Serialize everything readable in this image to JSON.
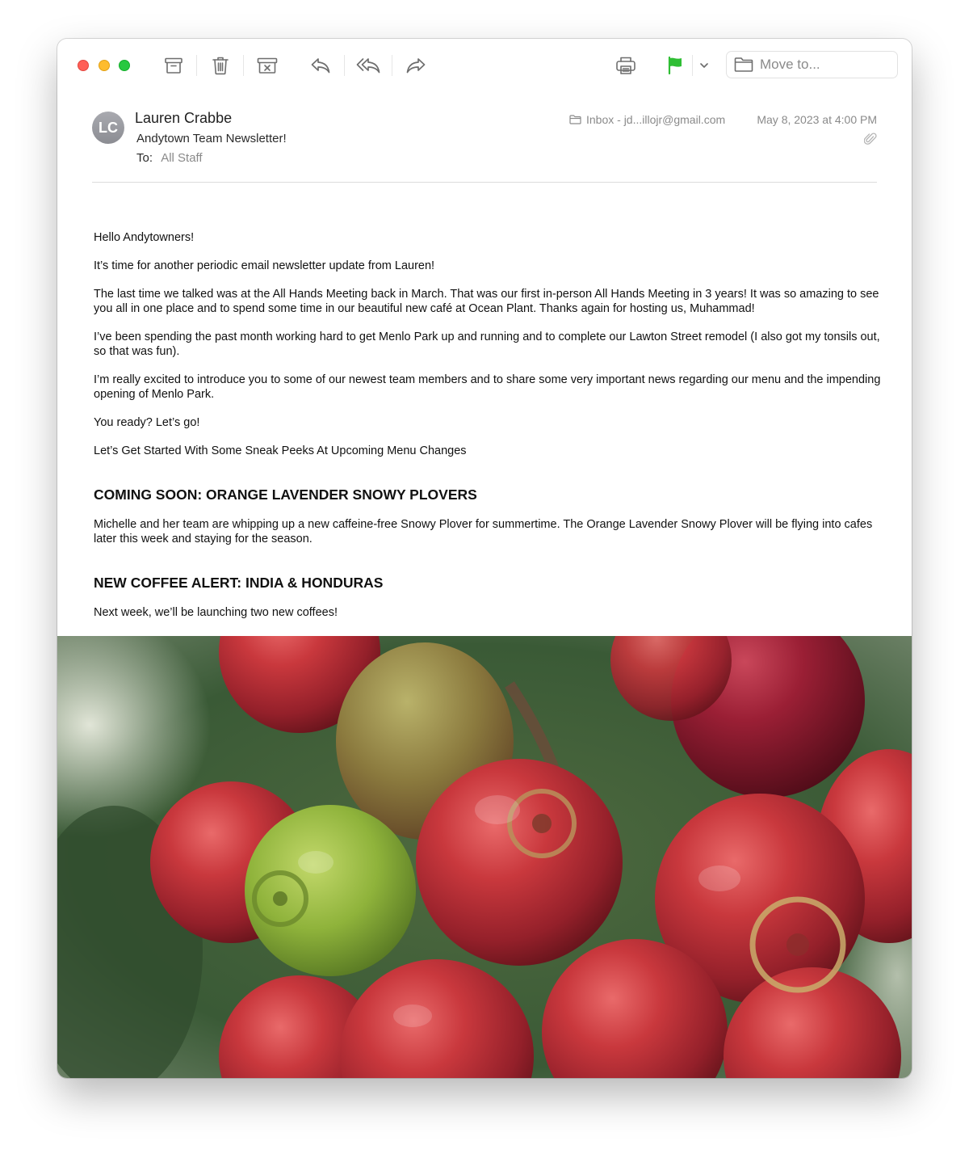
{
  "toolbar": {
    "icons": [
      "archive-icon",
      "trash-icon",
      "junk-icon",
      "reply-icon",
      "reply-all-icon",
      "forward-icon",
      "print-icon",
      "flag-icon",
      "chevron-down-icon"
    ],
    "move_to_label": "Move to...",
    "flag_color": "#2fbe34"
  },
  "message": {
    "avatar_initials": "LC",
    "sender": "Lauren Crabbe",
    "subject": "Andytown Team Newsletter!",
    "to_label": "To:",
    "to_value": "All Staff",
    "mailbox": "Inbox - jd...illojr@gmail.com",
    "date": "May 8, 2023 at 4:00 PM"
  },
  "body": {
    "greeting": "Hello Andytowners!",
    "p1": "It’s time for another periodic email newsletter update from Lauren!",
    "p2": "The last time we talked was at the All Hands Meeting back in March. That was our first in-person All Hands Meeting in 3 years! It was so amazing to see you all in one place and to spend some time in our beautiful new café at Ocean Plant. Thanks again for hosting us, Muhammad!",
    "p3": "I’ve been spending the past month working hard to get Menlo Park up and running and to complete our Lawton Street remodel (I also got my tonsils out, so that was fun).",
    "p4": "I’m really excited to introduce you to some of our newest team members and to share some very important news regarding our menu and the impending opening of Menlo Park.",
    "p5": "You ready? Let’s go!",
    "p6": "Let’s Get Started With Some Sneak Peeks At Upcoming Menu Changes",
    "h1": "COMING SOON: ORANGE LAVENDER SNOWY PLOVERS",
    "p7": "Michelle and her team are whipping up a new caffeine-free Snowy Plover for summertime. The Orange Lavender Snowy Plover will be flying into cafes later this week and staying for the season.",
    "h2": "NEW COFFEE ALERT: INDIA & HONDURAS",
    "p8": "Next week, we’ll be launching two new coffees!"
  },
  "image": {
    "subject": "coffee-cherries-photo"
  }
}
